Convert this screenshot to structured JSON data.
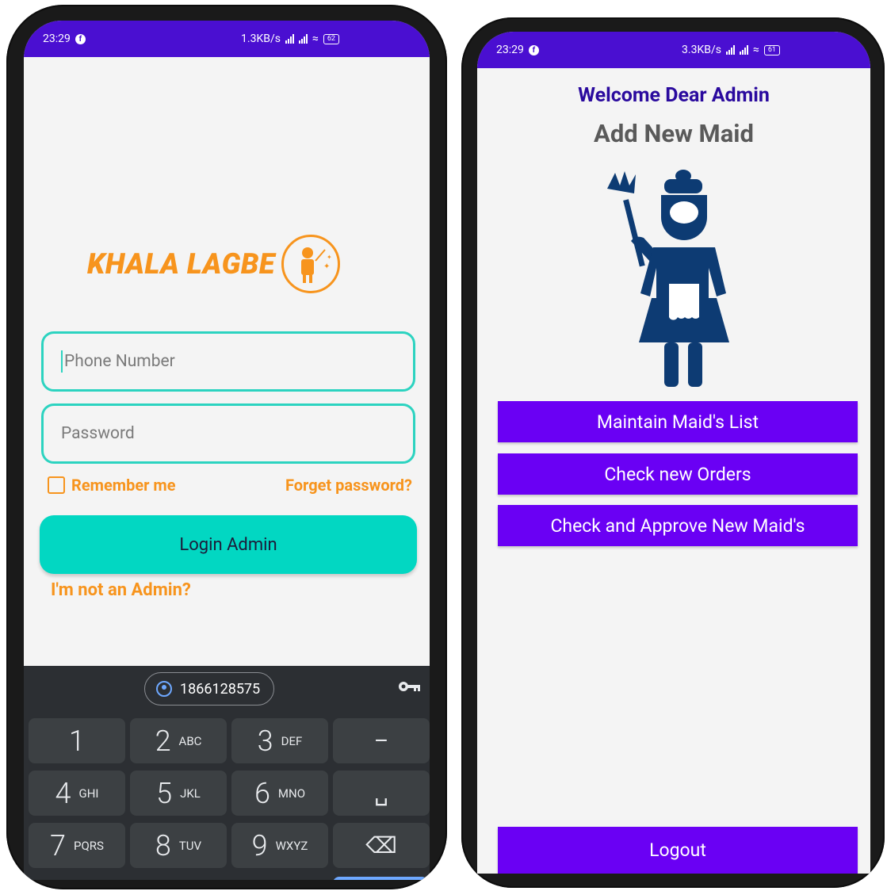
{
  "left_screen": {
    "status_bar": {
      "time": "23:29",
      "network_speed": "1.3KB/s",
      "battery": "62"
    },
    "logo": {
      "text": "KHALA LAGBE"
    },
    "phone_field": {
      "placeholder": "Phone Number"
    },
    "password_field": {
      "placeholder": "Password"
    },
    "remember_label": "Remember me",
    "forget_label": "Forget password?",
    "login_button": "Login Admin",
    "not_admin_link": "I'm not an Admin?",
    "keyboard": {
      "suggestion": "1866128575",
      "keys": [
        {
          "num": "1",
          "letters": ""
        },
        {
          "num": "2",
          "letters": "ABC"
        },
        {
          "num": "3",
          "letters": "DEF"
        },
        {
          "num": "–",
          "letters": ""
        },
        {
          "num": "4",
          "letters": "GHI"
        },
        {
          "num": "5",
          "letters": "JKL"
        },
        {
          "num": "6",
          "letters": "MNO"
        },
        {
          "num": "␣",
          "letters": ""
        },
        {
          "num": "7",
          "letters": "PQRS"
        },
        {
          "num": "8",
          "letters": "TUV"
        },
        {
          "num": "9",
          "letters": "WXYZ"
        },
        {
          "num": "⌫",
          "letters": ""
        }
      ]
    }
  },
  "right_screen": {
    "status_bar": {
      "time": "23:29",
      "network_speed": "3.3KB/s",
      "battery": "61"
    },
    "welcome": "Welcome Dear Admin",
    "subtitle": "Add New Maid",
    "buttons": {
      "maintain": "Maintain Maid's List",
      "orders": "Check new Orders",
      "approve": "Check and Approve New Maid's",
      "logout": "Logout"
    }
  },
  "colors": {
    "status_bar": "#4a0fd1",
    "accent_orange": "#f7941d",
    "teal": "#02d7c2",
    "purple_button": "#6a00f4",
    "maid_navy": "#0d3b73"
  }
}
